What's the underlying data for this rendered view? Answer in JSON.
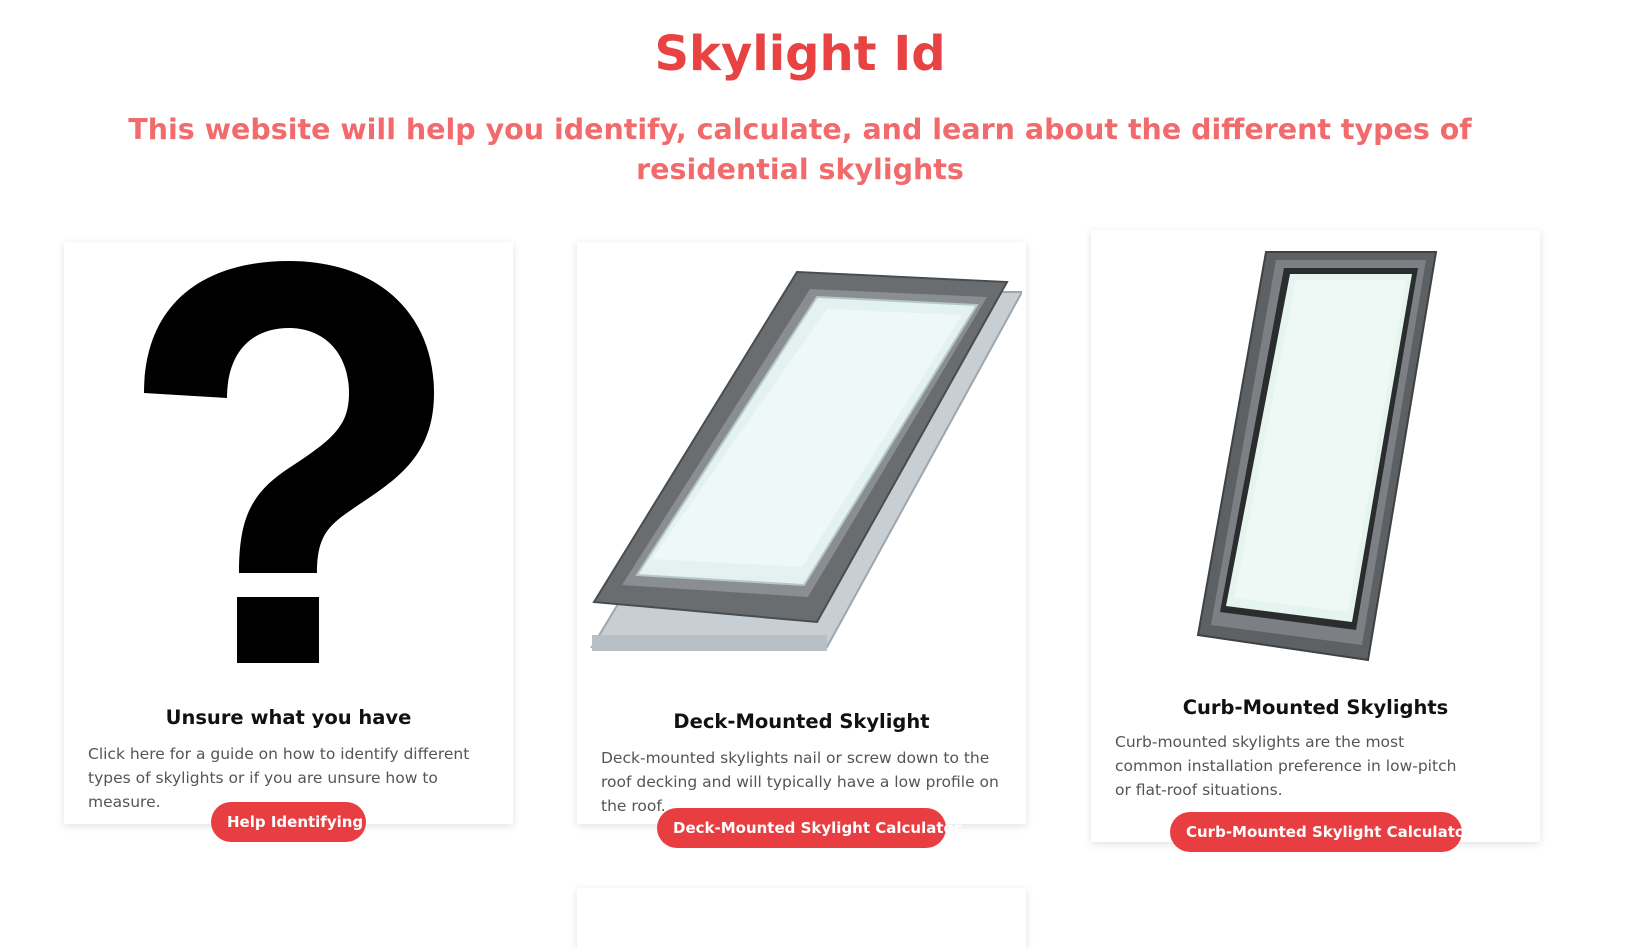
{
  "header": {
    "title": "Skylight Id",
    "subtitle": "This website will help you identify, calculate, and learn about the different types of residential skylights"
  },
  "cards": [
    {
      "image_icon": "question-mark-icon",
      "title": "Unsure what you have",
      "text": "Click here for a guide on how to identify different types of skylights or if you are unsure how to measure.",
      "button_label": "Help Identifying"
    },
    {
      "image_icon": "deck-mounted-skylight-image",
      "title": "Deck-Mounted Skylight",
      "text": "Deck-mounted skylights nail or screw down to the roof decking and will typically have a low profile on the roof.",
      "button_label": "Deck-Mounted Skylight Calculator"
    },
    {
      "image_icon": "curb-mounted-skylight-image",
      "title": "Curb-Mounted Skylights",
      "text": "Curb-mounted skylights are the most common installation preference in low-pitch or flat-roof situations.",
      "button_label": "Curb-Mounted Skylight Calculator"
    }
  ],
  "colors": {
    "title": "#e94242",
    "subtitle": "#f16a6c",
    "button": "#e83e41"
  }
}
